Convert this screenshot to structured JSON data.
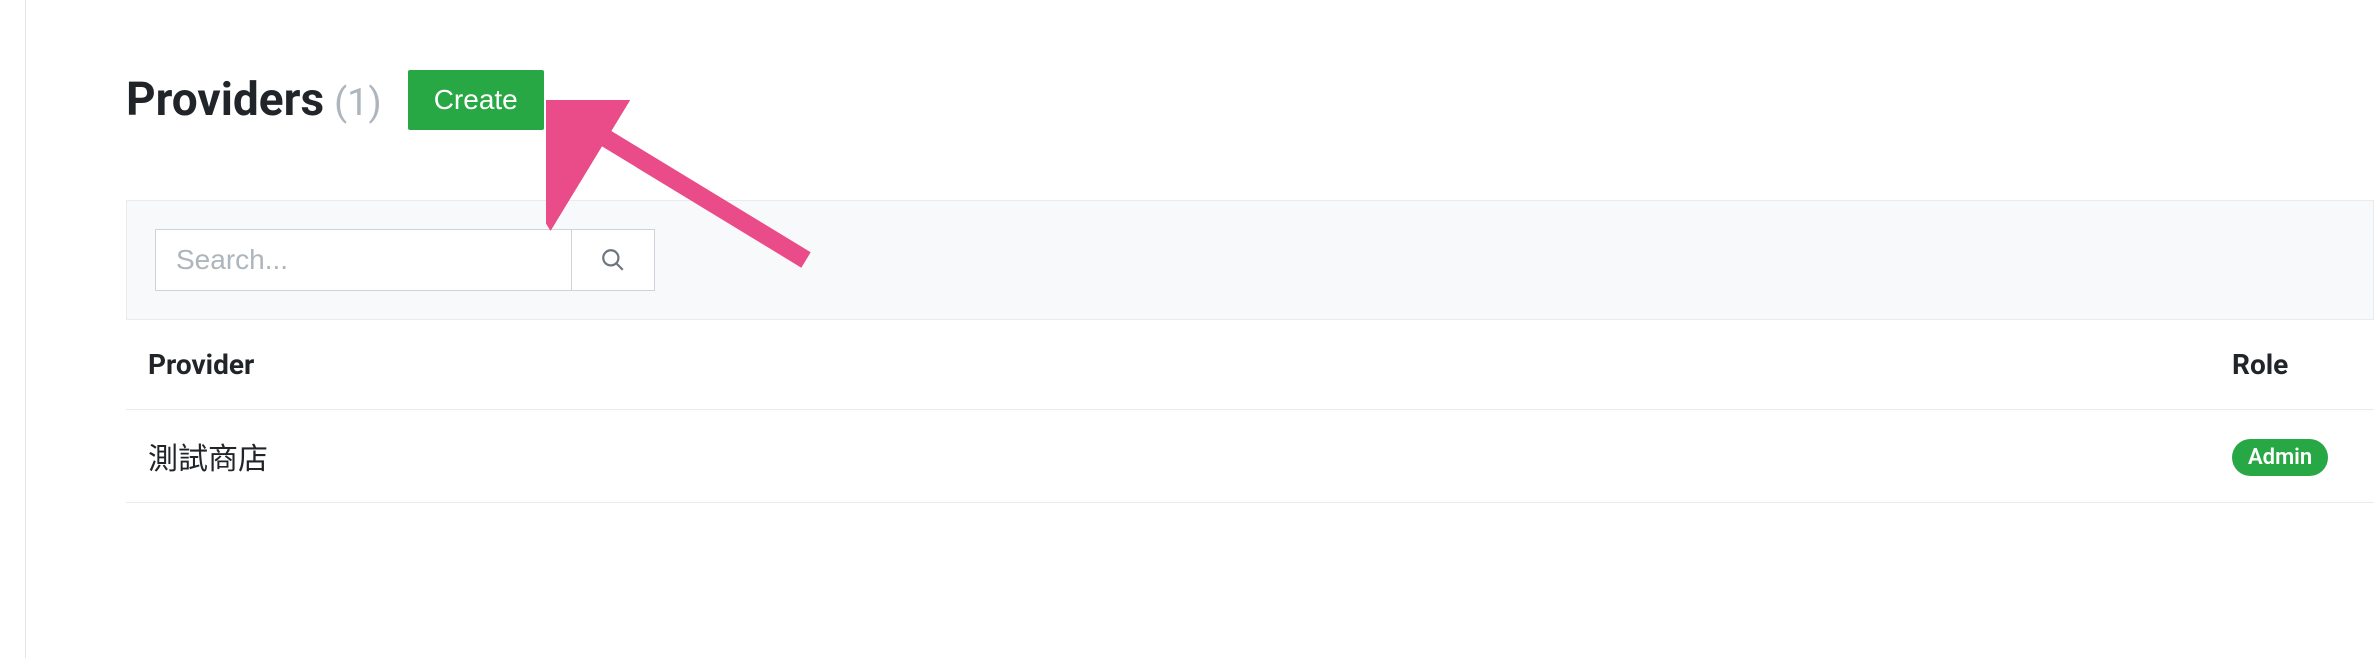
{
  "header": {
    "title": "Providers",
    "count": "(1)",
    "create_label": "Create"
  },
  "search": {
    "placeholder": "Search..."
  },
  "table": {
    "columns": {
      "provider": "Provider",
      "role": "Role"
    },
    "rows": [
      {
        "provider": "測試商店",
        "role": "Admin"
      }
    ]
  },
  "colors": {
    "primary_green": "#28a745",
    "annotation_pink": "#ea4c89"
  }
}
